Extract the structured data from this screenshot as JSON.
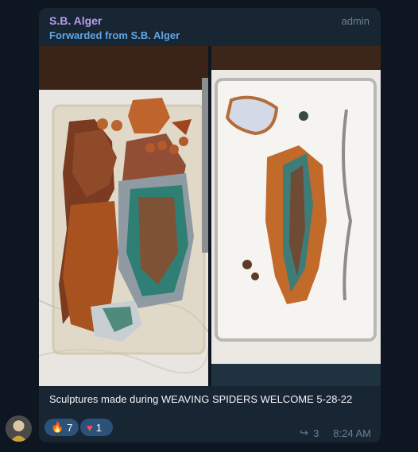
{
  "message": {
    "sender": "S.B. Alger",
    "role": "admin",
    "forwarded": "Forwarded from S.B. Alger",
    "caption": "Sculptures made during WEAVING SPIDERS WELCOME 5-28-22",
    "reactions": [
      {
        "emoji": "🔥",
        "count": "7"
      },
      {
        "emoji": "♥",
        "count": "1"
      }
    ],
    "forwards": "3",
    "time": "8:24 AM"
  },
  "colors": {
    "bubble": "#182533",
    "background": "#0e1621",
    "sender": "#b79cf0",
    "link": "#5fa6e3",
    "reaction": "#2b5278"
  }
}
